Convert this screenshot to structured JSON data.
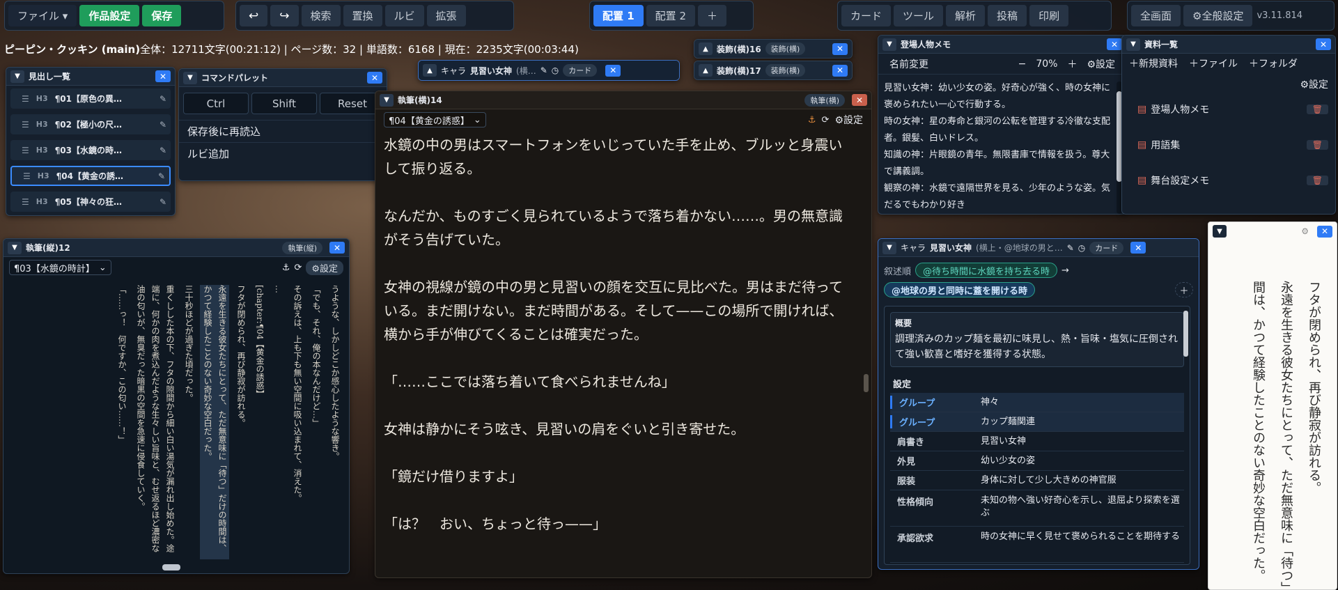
{
  "toolbar": {
    "file": "ファイル ▾",
    "work_settings": "作品設定",
    "save": "保存",
    "undo": "↩",
    "redo": "↪",
    "search": "検索",
    "replace": "置換",
    "ruby": "ルビ",
    "expand": "拡張",
    "layout1": "配置 1",
    "layout2": "配置 2",
    "layout_add": "＋",
    "card": "カード",
    "tool": "ツール",
    "analysis": "解析",
    "post": "投稿",
    "print": "印刷",
    "fullscreen": "全画面",
    "global_settings": "⚙全般設定",
    "version": "v3.11.814"
  },
  "status": {
    "title": "ピーピン・クッキン (main)",
    "stats": "全体：12711文字(00:21:12) | ページ数：32 | 単語数：6168 | 現在：2235文字(00:03:44)"
  },
  "outline": {
    "title": "見出し一覧",
    "items": [
      {
        "level": "H3",
        "label": "¶01【原色の異…"
      },
      {
        "level": "H3",
        "label": "¶02【極小の尺…"
      },
      {
        "level": "H3",
        "label": "¶03【水鏡の時…"
      },
      {
        "level": "H3",
        "label": "¶04【黄金の誘…"
      },
      {
        "level": "H3",
        "label": "¶05【神々の狂…"
      }
    ]
  },
  "palette": {
    "title": "コマンドパレット",
    "keys": [
      "Ctrl",
      "Shift",
      "Reset"
    ],
    "items": [
      "保存後に再読込",
      "ルビ追加"
    ]
  },
  "chara_float": {
    "label": "キャラ",
    "name": "見習い女神",
    "sub": "(横…",
    "card": "カード"
  },
  "deco": [
    {
      "title": "装飾(横)16",
      "tag": "装飾(横)"
    },
    {
      "title": "装飾(横)17",
      "tag": "装飾(横)"
    }
  ],
  "editor_h": {
    "title": "執筆(横)14",
    "tag": "執筆(横)",
    "chapter": "¶04【黄金の誘惑】",
    "settings": "⚙設定",
    "paragraphs": [
      "水鏡の中の男はスマートフォンをいじっていた手を止め、ブルッと身震いして振り返る。",
      "なんだか、ものすごく見られているようで落ち着かない……。男の無意識がそう告げていた。",
      "女神の視線が鏡の中の男と見習いの顔を交互に見比べた。男はまだ待っている。まだ開けない。まだ時間がある。そして——この場所で開ければ、横から手が伸びてくることは確実だった。",
      "「……ここでは落ち着いて食べられませんね」",
      "女神は静かにそう呟き、見習いの肩をぐいと引き寄せた。",
      "「鏡だけ借りますよ」",
      "「は？　おい、ちょっと待っ——」"
    ]
  },
  "editor_v": {
    "title": "執筆(縦)12",
    "tag": "執筆(縦)",
    "chapter": "¶03【水鏡の時計】",
    "settings": "⚙設定",
    "lines": [
      "うような、しかしどこか感心したような響き。",
      "「でも、それ、俺の本なんだけど…」",
      "その訴えは、上も下も無い空間に吸い込まれて、消えた。",
      "…",
      "[chapter:¶04【黄金の誘惑】",
      "フタが閉められ、再び静寂が訪れる。",
      "永遠を生きる彼女たちにとって、ただ無意味に「待つ」だけの時間は、かつて経験したことのない奇妙な空白だった。",
      "三十秒ほどが過ぎた頃だった。",
      "重くしした本の下、フタの隙間から細い白い湯気が漏れ出し始めた。途端に、何かの肉を煮込んだような生々しい旨味と、むせ返るほど濃密な油の匂いが、無臭だった暗黒の空間を急速に侵食していく。",
      "「……っ！　何ですか、この匂い……！」"
    ]
  },
  "memo": {
    "title": "登場人物メモ",
    "rename": "名前変更",
    "zoom": "70%",
    "settings": "⚙設定",
    "lines": [
      "見習い女神：幼い少女の姿。好奇心が強く、時の女神に褒められたい一心で行動する。",
      "時の女神：星の寿命と銀河の公転を管理する冷徹な支配者。銀髪、白いドレス。",
      "知識の神：片眼鏡の青年。無限書庫で情報を扱う。尊大で講義調。",
      "観察の神：水鏡で遠隔世界を見る、少年のような姿。気だるでもわかり好き"
    ]
  },
  "materials": {
    "title": "資料一覧",
    "new": "＋新規資料",
    "file": "＋ファイル",
    "folder": "＋フォルダ",
    "settings": "⚙設定",
    "items": [
      "登場人物メモ",
      "用語集",
      "舞台設定メモ"
    ]
  },
  "chara_panel": {
    "label": "キャラ",
    "name": "見習い女神",
    "sub": "(横上・@地球の男と…",
    "card": "カード",
    "order_label": "叙述順",
    "chip1": "@待ち時間に水鏡を持ち去る時",
    "arrow": "→",
    "chip2": "@地球の男と同時に蓋を開ける時",
    "plus": "＋",
    "summary_label": "概要",
    "summary": "調理済みのカップ麺を最初に味見し、熱・旨味・塩気に圧倒されて強い歓喜と嗜好を獲得する状態。",
    "settings_label": "設定",
    "rows": [
      {
        "k": "グループ",
        "v": "神々",
        "g": true
      },
      {
        "k": "グループ",
        "v": "カップ麺関連",
        "g": true
      },
      {
        "k": "肩書き",
        "v": "見習い女神"
      },
      {
        "k": "外見",
        "v": "幼い少女の姿"
      },
      {
        "k": "服装",
        "v": "身体に対して少し大きめの神官服"
      },
      {
        "k": "性格傾向",
        "v": "未知の物へ強い好奇心を示し、退屈より探索を選ぶ"
      },
      {
        "k": "承認欲求",
        "v": "時の女神に早く見せて褒められることを期待する"
      }
    ]
  },
  "preview": {
    "lines": [
      "フタが閉められ、再び静寂が訪れる。",
      "永遠を生きる彼女たちにとって、ただ無意味に「待つ」",
      "間は、かつて経験したことのない奇妙な空白だった。"
    ]
  }
}
